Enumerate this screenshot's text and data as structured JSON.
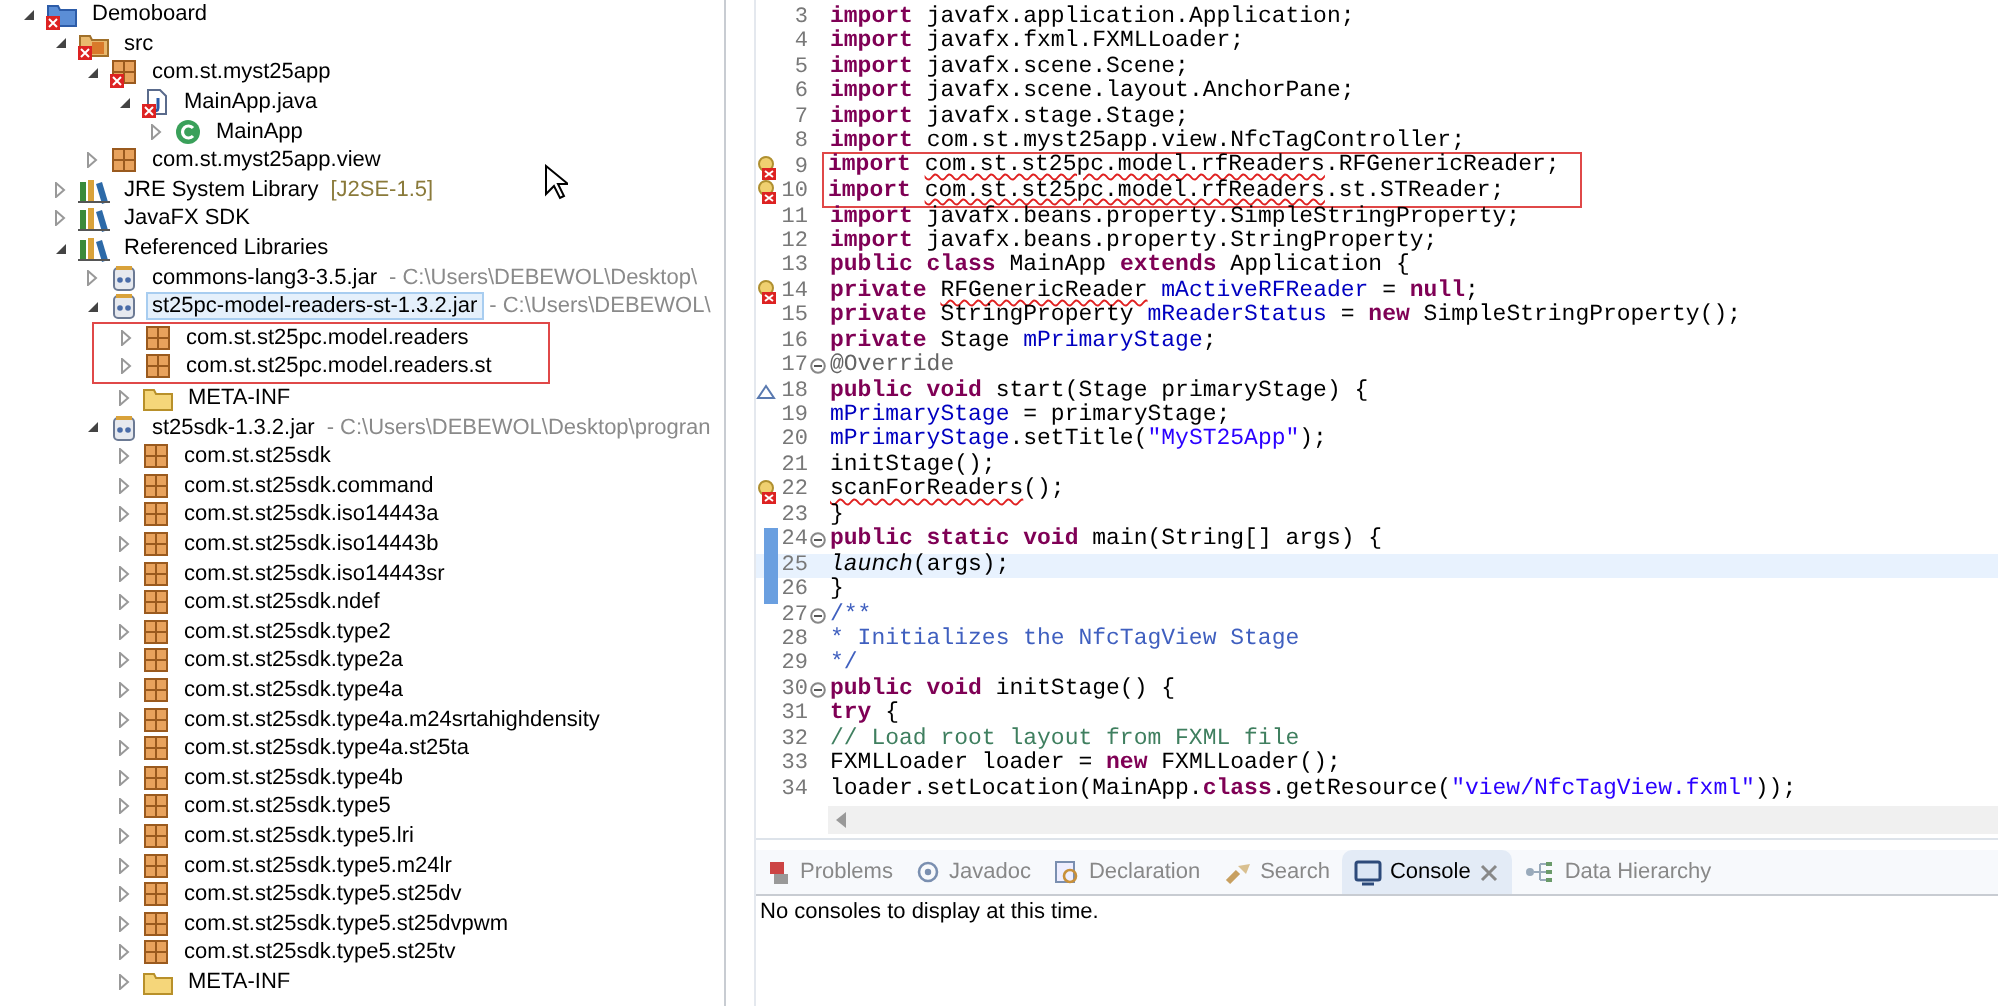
{
  "package_explorer": {
    "tree": [
      {
        "label": "Demoboard",
        "kind": "project",
        "error": true,
        "expanded": true,
        "selected": false,
        "highlighted": false,
        "children": [
          {
            "label": "src",
            "kind": "source-folder",
            "error": true,
            "expanded": true,
            "selected": false,
            "highlighted": false,
            "children": [
              {
                "label": "com.st.myst25app",
                "kind": "package",
                "error": true,
                "expanded": true,
                "selected": false,
                "highlighted": false,
                "children": [
                  {
                    "label": "MainApp.java",
                    "kind": "java-file",
                    "error": true,
                    "expanded": true,
                    "selected": false,
                    "highlighted": false,
                    "children": [
                      {
                        "label": "MainApp",
                        "kind": "class",
                        "error": false,
                        "expanded": false,
                        "selected": false,
                        "highlighted": false
                      }
                    ]
                  }
                ]
              },
              {
                "label": "com.st.myst25app.view",
                "kind": "package",
                "error": false,
                "expanded": false,
                "selected": false,
                "highlighted": false
              }
            ]
          },
          {
            "label": "JRE System Library",
            "detail": "[J2SE-1.5]",
            "kind": "library",
            "error": false,
            "expanded": false,
            "selected": false,
            "highlighted": false
          },
          {
            "label": "JavaFX SDK",
            "kind": "library",
            "error": false,
            "expanded": false,
            "selected": false,
            "highlighted": false
          },
          {
            "label": "Referenced Libraries",
            "kind": "library",
            "error": false,
            "expanded": true,
            "selected": false,
            "highlighted": false,
            "children": [
              {
                "label": "commons-lang3-3.5.jar",
                "detail": "- C:\\Users\\DEBEWOL\\Desktop\\",
                "kind": "jar",
                "error": false,
                "expanded": false,
                "selected": false,
                "highlighted": false
              },
              {
                "label": "st25pc-model-readers-st-1.3.2.jar",
                "detail": "- C:\\Users\\DEBEWOL\\",
                "kind": "jar",
                "error": false,
                "expanded": true,
                "selected": true,
                "highlighted": false,
                "children": [
                  {
                    "label": "com.st.st25pc.model.readers",
                    "kind": "package",
                    "error": false,
                    "expanded": false,
                    "selected": false,
                    "highlighted": true
                  },
                  {
                    "label": "com.st.st25pc.model.readers.st",
                    "kind": "package",
                    "error": false,
                    "expanded": false,
                    "selected": false,
                    "highlighted": true
                  },
                  {
                    "label": "META-INF",
                    "kind": "folder",
                    "error": false,
                    "expanded": false,
                    "selected": false,
                    "highlighted": false
                  }
                ]
              },
              {
                "label": "st25sdk-1.3.2.jar",
                "detail": "- C:\\Users\\DEBEWOL\\Desktop\\progran",
                "kind": "jar",
                "error": false,
                "expanded": true,
                "selected": false,
                "highlighted": false,
                "children": [
                  {
                    "label": "com.st.st25sdk",
                    "kind": "package",
                    "error": false,
                    "expanded": false,
                    "selected": false,
                    "highlighted": false
                  },
                  {
                    "label": "com.st.st25sdk.command",
                    "kind": "package",
                    "error": false,
                    "expanded": false,
                    "selected": false,
                    "highlighted": false
                  },
                  {
                    "label": "com.st.st25sdk.iso14443a",
                    "kind": "package",
                    "error": false,
                    "expanded": false,
                    "selected": false,
                    "highlighted": false
                  },
                  {
                    "label": "com.st.st25sdk.iso14443b",
                    "kind": "package",
                    "error": false,
                    "expanded": false,
                    "selected": false,
                    "highlighted": false
                  },
                  {
                    "label": "com.st.st25sdk.iso14443sr",
                    "kind": "package",
                    "error": false,
                    "expanded": false,
                    "selected": false,
                    "highlighted": false
                  },
                  {
                    "label": "com.st.st25sdk.ndef",
                    "kind": "package",
                    "error": false,
                    "expanded": false,
                    "selected": false,
                    "highlighted": false
                  },
                  {
                    "label": "com.st.st25sdk.type2",
                    "kind": "package",
                    "error": false,
                    "expanded": false,
                    "selected": false,
                    "highlighted": false
                  },
                  {
                    "label": "com.st.st25sdk.type2a",
                    "kind": "package",
                    "error": false,
                    "expanded": false,
                    "selected": false,
                    "highlighted": false
                  },
                  {
                    "label": "com.st.st25sdk.type4a",
                    "kind": "package",
                    "error": false,
                    "expanded": false,
                    "selected": false,
                    "highlighted": false
                  },
                  {
                    "label": "com.st.st25sdk.type4a.m24srtahighdensity",
                    "kind": "package",
                    "error": false,
                    "expanded": false,
                    "selected": false,
                    "highlighted": false
                  },
                  {
                    "label": "com.st.st25sdk.type4a.st25ta",
                    "kind": "package",
                    "error": false,
                    "expanded": false,
                    "selected": false,
                    "highlighted": false
                  },
                  {
                    "label": "com.st.st25sdk.type4b",
                    "kind": "package",
                    "error": false,
                    "expanded": false,
                    "selected": false,
                    "highlighted": false
                  },
                  {
                    "label": "com.st.st25sdk.type5",
                    "kind": "package",
                    "error": false,
                    "expanded": false,
                    "selected": false,
                    "highlighted": false
                  },
                  {
                    "label": "com.st.st25sdk.type5.lri",
                    "kind": "package",
                    "error": false,
                    "expanded": false,
                    "selected": false,
                    "highlighted": false
                  },
                  {
                    "label": "com.st.st25sdk.type5.m24lr",
                    "kind": "package",
                    "error": false,
                    "expanded": false,
                    "selected": false,
                    "highlighted": false
                  },
                  {
                    "label": "com.st.st25sdk.type5.st25dv",
                    "kind": "package",
                    "error": false,
                    "expanded": false,
                    "selected": false,
                    "highlighted": false
                  },
                  {
                    "label": "com.st.st25sdk.type5.st25dvpwm",
                    "kind": "package",
                    "error": false,
                    "expanded": false,
                    "selected": false,
                    "highlighted": false
                  },
                  {
                    "label": "com.st.st25sdk.type5.st25tv",
                    "kind": "package",
                    "error": false,
                    "expanded": false,
                    "selected": false,
                    "highlighted": false
                  },
                  {
                    "label": "META-INF",
                    "kind": "folder",
                    "error": false,
                    "expanded": false,
                    "selected": false,
                    "highlighted": false
                  }
                ]
              }
            ]
          }
        ]
      }
    ]
  },
  "editor": {
    "lines": [
      {
        "number": "3",
        "error": false,
        "override": false,
        "fold": false,
        "current": false,
        "in_range": false,
        "highlighted": false,
        "tokens": [
          {
            "kind": "keyword",
            "text": "import"
          },
          {
            "kind": "plain",
            "text": " javafx.application.Application;"
          }
        ]
      },
      {
        "number": "4",
        "error": false,
        "override": false,
        "fold": false,
        "current": false,
        "in_range": false,
        "highlighted": false,
        "tokens": [
          {
            "kind": "keyword",
            "text": "import"
          },
          {
            "kind": "plain",
            "text": " javafx.fxml.FXMLLoader;"
          }
        ]
      },
      {
        "number": "5",
        "error": false,
        "override": false,
        "fold": false,
        "current": false,
        "in_range": false,
        "highlighted": false,
        "tokens": [
          {
            "kind": "keyword",
            "text": "import"
          },
          {
            "kind": "plain",
            "text": " javafx.scene.Scene;"
          }
        ]
      },
      {
        "number": "6",
        "error": false,
        "override": false,
        "fold": false,
        "current": false,
        "in_range": false,
        "highlighted": false,
        "tokens": [
          {
            "kind": "keyword",
            "text": "import"
          },
          {
            "kind": "plain",
            "text": " javafx.scene.layout.AnchorPane;"
          }
        ]
      },
      {
        "number": "7",
        "error": false,
        "override": false,
        "fold": false,
        "current": false,
        "in_range": false,
        "highlighted": false,
        "tokens": [
          {
            "kind": "keyword",
            "text": "import"
          },
          {
            "kind": "plain",
            "text": " javafx.stage.Stage;"
          }
        ]
      },
      {
        "number": "8",
        "error": false,
        "override": false,
        "fold": false,
        "current": false,
        "in_range": false,
        "highlighted": false,
        "tokens": [
          {
            "kind": "keyword",
            "text": "import"
          },
          {
            "kind": "plain",
            "text": " com.st.myst25app.view.NfcTagController;"
          }
        ]
      },
      {
        "number": "9",
        "error": true,
        "override": false,
        "fold": false,
        "current": false,
        "in_range": false,
        "highlighted": true,
        "tokens": [
          {
            "kind": "keyword",
            "text": "import "
          },
          {
            "kind": "error",
            "text": "com.st.st25pc.model.rfReaders"
          },
          {
            "kind": "plain",
            "text": ".RFGenericReader;"
          }
        ]
      },
      {
        "number": "10",
        "error": true,
        "override": false,
        "fold": false,
        "current": false,
        "in_range": false,
        "highlighted": true,
        "tokens": [
          {
            "kind": "keyword",
            "text": "import "
          },
          {
            "kind": "error",
            "text": "com.st.st25pc.model.rfReaders"
          },
          {
            "kind": "plain",
            "text": ".st.STReader;"
          }
        ]
      },
      {
        "number": "11",
        "error": false,
        "override": false,
        "fold": false,
        "current": false,
        "in_range": false,
        "highlighted": false,
        "tokens": [
          {
            "kind": "keyword",
            "text": "import"
          },
          {
            "kind": "plain",
            "text": " javafx.beans.property.SimpleStringProperty;"
          }
        ]
      },
      {
        "number": "12",
        "error": false,
        "override": false,
        "fold": false,
        "current": false,
        "in_range": false,
        "highlighted": false,
        "tokens": [
          {
            "kind": "keyword",
            "text": "import"
          },
          {
            "kind": "plain",
            "text": " javafx.beans.property.StringProperty;"
          }
        ]
      },
      {
        "number": "13",
        "error": false,
        "override": false,
        "fold": false,
        "current": false,
        "in_range": false,
        "highlighted": false,
        "tokens": [
          {
            "kind": "keyword",
            "text": "public class"
          },
          {
            "kind": "plain",
            "text": " MainApp "
          },
          {
            "kind": "keyword",
            "text": "extends"
          },
          {
            "kind": "plain",
            "text": " Application {"
          }
        ]
      },
      {
        "number": "14",
        "error": true,
        "override": false,
        "fold": false,
        "current": false,
        "in_range": false,
        "highlighted": false,
        "tokens": [
          {
            "kind": "keyword",
            "text": "private "
          },
          {
            "kind": "error",
            "text": "RFGenericReader"
          },
          {
            "kind": "field",
            "text": " mActiveRFReader"
          },
          {
            "kind": "plain",
            "text": " = "
          },
          {
            "kind": "keyword",
            "text": "null"
          },
          {
            "kind": "plain",
            "text": ";"
          }
        ]
      },
      {
        "number": "15",
        "error": false,
        "override": false,
        "fold": false,
        "current": false,
        "in_range": false,
        "highlighted": false,
        "tokens": [
          {
            "kind": "keyword",
            "text": "private"
          },
          {
            "kind": "plain",
            "text": " StringProperty "
          },
          {
            "kind": "field",
            "text": "mReaderStatus"
          },
          {
            "kind": "plain",
            "text": " = "
          },
          {
            "kind": "keyword",
            "text": "new"
          },
          {
            "kind": "plain",
            "text": " SimpleStringProperty();"
          }
        ]
      },
      {
        "number": "16",
        "error": false,
        "override": false,
        "fold": false,
        "current": false,
        "in_range": false,
        "highlighted": false,
        "tokens": [
          {
            "kind": "keyword",
            "text": "private"
          },
          {
            "kind": "plain",
            "text": " Stage "
          },
          {
            "kind": "field",
            "text": "mPrimaryStage"
          },
          {
            "kind": "plain",
            "text": ";"
          }
        ]
      },
      {
        "number": "17",
        "error": false,
        "override": false,
        "fold": true,
        "current": false,
        "in_range": false,
        "highlighted": false,
        "tokens": [
          {
            "kind": "annotation",
            "text": "@Override"
          }
        ]
      },
      {
        "number": "18",
        "error": false,
        "override": true,
        "fold": false,
        "current": false,
        "in_range": false,
        "highlighted": false,
        "tokens": [
          {
            "kind": "keyword",
            "text": "public void"
          },
          {
            "kind": "plain",
            "text": " start(Stage primaryStage) {"
          }
        ]
      },
      {
        "number": "19",
        "error": false,
        "override": false,
        "fold": false,
        "current": false,
        "in_range": false,
        "highlighted": false,
        "tokens": [
          {
            "kind": "field",
            "text": "mPrimaryStage"
          },
          {
            "kind": "plain",
            "text": " = primaryStage;"
          }
        ]
      },
      {
        "number": "20",
        "error": false,
        "override": false,
        "fold": false,
        "current": false,
        "in_range": false,
        "highlighted": false,
        "tokens": [
          {
            "kind": "field",
            "text": "mPrimaryStage"
          },
          {
            "kind": "plain",
            "text": ".setTitle("
          },
          {
            "kind": "string",
            "text": "\"MyST25App\""
          },
          {
            "kind": "plain",
            "text": ");"
          }
        ]
      },
      {
        "number": "21",
        "error": false,
        "override": false,
        "fold": false,
        "current": false,
        "in_range": false,
        "highlighted": false,
        "tokens": [
          {
            "kind": "plain",
            "text": "initStage();"
          }
        ]
      },
      {
        "number": "22",
        "error": true,
        "override": false,
        "fold": false,
        "current": false,
        "in_range": false,
        "highlighted": false,
        "tokens": [
          {
            "kind": "error",
            "text": "scanForReaders"
          },
          {
            "kind": "plain",
            "text": "();"
          }
        ]
      },
      {
        "number": "23",
        "error": false,
        "override": false,
        "fold": false,
        "current": false,
        "in_range": false,
        "highlighted": false,
        "tokens": [
          {
            "kind": "plain",
            "text": "}"
          }
        ]
      },
      {
        "number": "24",
        "error": false,
        "override": false,
        "fold": true,
        "current": false,
        "in_range": true,
        "highlighted": false,
        "tokens": [
          {
            "kind": "keyword",
            "text": "public static void"
          },
          {
            "kind": "plain",
            "text": " main(String[] args) {"
          }
        ]
      },
      {
        "number": "25",
        "error": false,
        "override": false,
        "fold": false,
        "current": true,
        "in_range": true,
        "highlighted": false,
        "tokens": [
          {
            "kind": "static",
            "text": "launch"
          },
          {
            "kind": "plain",
            "text": "(args);"
          }
        ]
      },
      {
        "number": "26",
        "error": false,
        "override": false,
        "fold": false,
        "current": false,
        "in_range": true,
        "highlighted": false,
        "tokens": [
          {
            "kind": "plain",
            "text": "}"
          }
        ]
      },
      {
        "number": "27",
        "error": false,
        "override": false,
        "fold": true,
        "current": false,
        "in_range": false,
        "highlighted": false,
        "tokens": [
          {
            "kind": "javadoc",
            "text": "/**"
          }
        ]
      },
      {
        "number": "28",
        "error": false,
        "override": false,
        "fold": false,
        "current": false,
        "in_range": false,
        "highlighted": false,
        "tokens": [
          {
            "kind": "javadoc",
            "text": "* Initializes the NfcTagView Stage"
          }
        ]
      },
      {
        "number": "29",
        "error": false,
        "override": false,
        "fold": false,
        "current": false,
        "in_range": false,
        "highlighted": false,
        "tokens": [
          {
            "kind": "javadoc",
            "text": "*/"
          }
        ]
      },
      {
        "number": "30",
        "error": false,
        "override": false,
        "fold": true,
        "current": false,
        "in_range": false,
        "highlighted": false,
        "tokens": [
          {
            "kind": "keyword",
            "text": "public void"
          },
          {
            "kind": "plain",
            "text": " initStage() {"
          }
        ]
      },
      {
        "number": "31",
        "error": false,
        "override": false,
        "fold": false,
        "current": false,
        "in_range": false,
        "highlighted": false,
        "tokens": [
          {
            "kind": "keyword",
            "text": "try"
          },
          {
            "kind": "plain",
            "text": " {"
          }
        ]
      },
      {
        "number": "32",
        "error": false,
        "override": false,
        "fold": false,
        "current": false,
        "in_range": false,
        "highlighted": false,
        "tokens": [
          {
            "kind": "comment",
            "text": "// Load root layout from FXML file"
          }
        ]
      },
      {
        "number": "33",
        "error": false,
        "override": false,
        "fold": false,
        "current": false,
        "in_range": false,
        "highlighted": false,
        "tokens": [
          {
            "kind": "plain",
            "text": "FXMLLoader loader = "
          },
          {
            "kind": "keyword",
            "text": "new"
          },
          {
            "kind": "plain",
            "text": " FXMLLoader();"
          }
        ]
      },
      {
        "number": "34",
        "error": false,
        "override": false,
        "fold": false,
        "current": false,
        "in_range": false,
        "highlighted": false,
        "tokens": [
          {
            "kind": "plain",
            "text": "loader.setLocation(MainApp."
          },
          {
            "kind": "keyword",
            "text": "class"
          },
          {
            "kind": "plain",
            "text": ".getResource("
          },
          {
            "kind": "string",
            "text": "\"view/NfcTagView.fxml\""
          },
          {
            "kind": "plain",
            "text": "));"
          }
        ]
      }
    ]
  },
  "bottom_panel": {
    "tabs": [
      {
        "label": "Problems",
        "kind": "problems",
        "selected": false
      },
      {
        "label": "Javadoc",
        "kind": "javadoc",
        "selected": false
      },
      {
        "label": "Declaration",
        "kind": "declaration",
        "selected": false
      },
      {
        "label": "Search",
        "kind": "search",
        "selected": false
      },
      {
        "label": "Console",
        "kind": "console",
        "selected": true
      },
      {
        "label": "Data Hierarchy",
        "kind": "hierarchy",
        "selected": false
      }
    ],
    "message": "No consoles to display at this time."
  }
}
